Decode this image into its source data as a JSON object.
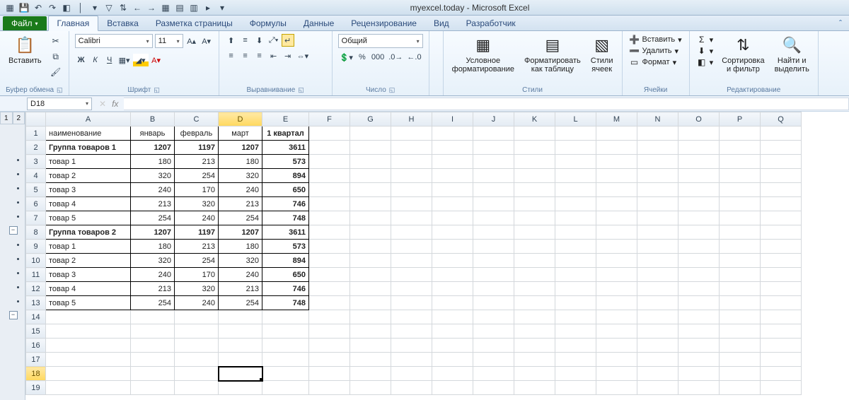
{
  "title": "myexcel.today - Microsoft Excel",
  "tabs": {
    "file": "Файл",
    "home": "Главная",
    "insert": "Вставка",
    "layout": "Разметка страницы",
    "formulas": "Формулы",
    "data": "Данные",
    "review": "Рецензирование",
    "view": "Вид",
    "developer": "Разработчик"
  },
  "ribbon": {
    "clipboard": {
      "label": "Буфер обмена",
      "paste": "Вставить"
    },
    "font": {
      "label": "Шрифт",
      "name": "Calibri",
      "size": "11"
    },
    "align": {
      "label": "Выравнивание"
    },
    "number": {
      "label": "Число",
      "format": "Общий"
    },
    "styles": {
      "label": "Стили",
      "cond": "Условное\nформатирование",
      "table": "Форматировать\nкак таблицу",
      "cell": "Стили\nячеек"
    },
    "cells": {
      "label": "Ячейки",
      "insert": "Вставить",
      "delete": "Удалить",
      "format": "Формат"
    },
    "editing": {
      "label": "Редактирование",
      "sort": "Сортировка\nи фильтр",
      "find": "Найти и\nвыделить"
    }
  },
  "namebox": "D18",
  "outline_levels": [
    "1",
    "2"
  ],
  "columns": [
    "A",
    "B",
    "C",
    "D",
    "E",
    "F",
    "G",
    "H",
    "I",
    "J",
    "K",
    "L",
    "M",
    "N",
    "O",
    "P",
    "Q"
  ],
  "selected_col": "D",
  "selected_row": 18,
  "headers": [
    "наименование",
    "январь",
    "февраль",
    "март",
    "1 квартал"
  ],
  "rows": [
    {
      "n": 1,
      "kind": "head"
    },
    {
      "n": 2,
      "kind": "group",
      "cells": [
        "Группа товаров 1",
        "1207",
        "1197",
        "1207",
        "3611"
      ]
    },
    {
      "n": 3,
      "kind": "item",
      "cells": [
        "товар 1",
        "180",
        "213",
        "180",
        "573"
      ]
    },
    {
      "n": 4,
      "kind": "item",
      "cells": [
        "товар 2",
        "320",
        "254",
        "320",
        "894"
      ]
    },
    {
      "n": 5,
      "kind": "item",
      "cells": [
        "товар 3",
        "240",
        "170",
        "240",
        "650"
      ]
    },
    {
      "n": 6,
      "kind": "item",
      "cells": [
        "товар 4",
        "213",
        "320",
        "213",
        "746"
      ]
    },
    {
      "n": 7,
      "kind": "item",
      "cells": [
        "товар 5",
        "254",
        "240",
        "254",
        "748"
      ]
    },
    {
      "n": 8,
      "kind": "group",
      "cells": [
        "Группа товаров 2",
        "1207",
        "1197",
        "1207",
        "3611"
      ]
    },
    {
      "n": 9,
      "kind": "item",
      "cells": [
        "товар 1",
        "180",
        "213",
        "180",
        "573"
      ]
    },
    {
      "n": 10,
      "kind": "item",
      "cells": [
        "товар 2",
        "320",
        "254",
        "320",
        "894"
      ]
    },
    {
      "n": 11,
      "kind": "item",
      "cells": [
        "товар 3",
        "240",
        "170",
        "240",
        "650"
      ]
    },
    {
      "n": 12,
      "kind": "item",
      "cells": [
        "товар 4",
        "213",
        "320",
        "213",
        "746"
      ]
    },
    {
      "n": 13,
      "kind": "item",
      "cells": [
        "товар 5",
        "254",
        "240",
        "254",
        "748"
      ]
    },
    {
      "n": 14,
      "kind": "blank"
    },
    {
      "n": 15,
      "kind": "blank"
    },
    {
      "n": 16,
      "kind": "blank"
    },
    {
      "n": 17,
      "kind": "blank"
    },
    {
      "n": 18,
      "kind": "blank"
    },
    {
      "n": 19,
      "kind": "blank"
    }
  ],
  "outline_marks": {
    "3": "dot",
    "4": "dot",
    "5": "dot",
    "6": "dot",
    "7": "dot",
    "8": "minus",
    "9": "dot",
    "10": "dot",
    "11": "dot",
    "12": "dot",
    "13": "dot",
    "14": "minus"
  }
}
